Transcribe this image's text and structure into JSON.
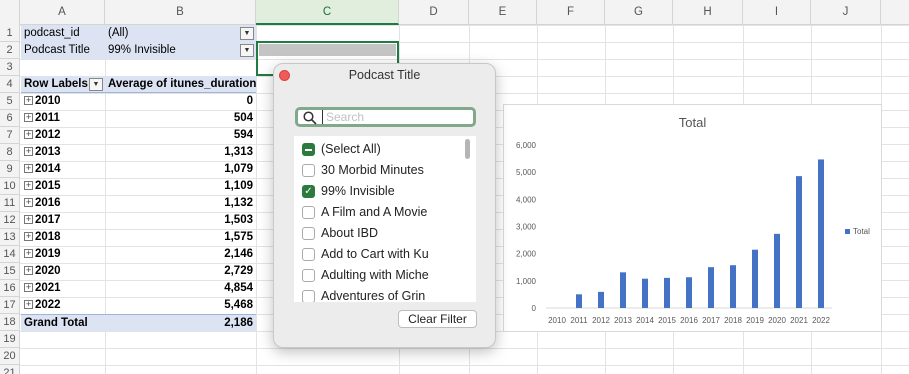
{
  "columns": [
    "A",
    "B",
    "C",
    "D",
    "E",
    "F",
    "G",
    "H",
    "I",
    "J"
  ],
  "rows": [
    "1",
    "2",
    "3",
    "4",
    "5",
    "6",
    "7",
    "8",
    "9",
    "10",
    "11",
    "12",
    "13",
    "14",
    "15",
    "16",
    "17",
    "18",
    "19",
    "20",
    "21"
  ],
  "filters": {
    "podcast_id_label": "podcast_id",
    "podcast_id_value": "(All)",
    "podcast_title_label": "Podcast Title",
    "podcast_title_value": "99% Invisible"
  },
  "pivot": {
    "row_labels_header": "Row Labels",
    "value_header": "Average of itunes_duration",
    "expand_symbol": "+",
    "rows": [
      {
        "year": "2010",
        "value": "0"
      },
      {
        "year": "2011",
        "value": "504"
      },
      {
        "year": "2012",
        "value": "594"
      },
      {
        "year": "2013",
        "value": "1,313"
      },
      {
        "year": "2014",
        "value": "1,079"
      },
      {
        "year": "2015",
        "value": "1,109"
      },
      {
        "year": "2016",
        "value": "1,132"
      },
      {
        "year": "2017",
        "value": "1,503"
      },
      {
        "year": "2018",
        "value": "1,575"
      },
      {
        "year": "2019",
        "value": "2,146"
      },
      {
        "year": "2020",
        "value": "2,729"
      },
      {
        "year": "2021",
        "value": "4,854"
      },
      {
        "year": "2022",
        "value": "5,468"
      }
    ],
    "grand_total_label": "Grand Total",
    "grand_total_value": "2,186"
  },
  "popup": {
    "title": "Podcast Title",
    "search_placeholder": "Search",
    "items": [
      {
        "label": "(Select All)",
        "state": "mixed"
      },
      {
        "label": "30 Morbid Minutes",
        "state": "unchecked"
      },
      {
        "label": "99% Invisible",
        "state": "checked"
      },
      {
        "label": "A Film and A Movie",
        "state": "unchecked"
      },
      {
        "label": "About IBD",
        "state": "unchecked"
      },
      {
        "label": "Add to Cart with Ku",
        "state": "unchecked"
      },
      {
        "label": "Adulting with Miche",
        "state": "unchecked"
      },
      {
        "label": "Adventures of Grin",
        "state": "unchecked"
      }
    ],
    "clear_filter_label": "Clear Filter"
  },
  "chart_data": {
    "type": "bar",
    "title": "Total",
    "categories": [
      "2010",
      "2011",
      "2012",
      "2013",
      "2014",
      "2015",
      "2016",
      "2017",
      "2018",
      "2019",
      "2020",
      "2021",
      "2022"
    ],
    "series": [
      {
        "name": "Total",
        "values": [
          0,
          504,
          594,
          1313,
          1079,
          1109,
          1132,
          1503,
          1575,
          2146,
          2729,
          4854,
          5468
        ],
        "color": "#4472c4"
      }
    ],
    "yticks": [
      "0",
      "1,000",
      "2,000",
      "3,000",
      "4,000",
      "5,000",
      "6,000"
    ],
    "ylim": [
      0,
      6000
    ],
    "legend_position": "right",
    "grid": false
  }
}
